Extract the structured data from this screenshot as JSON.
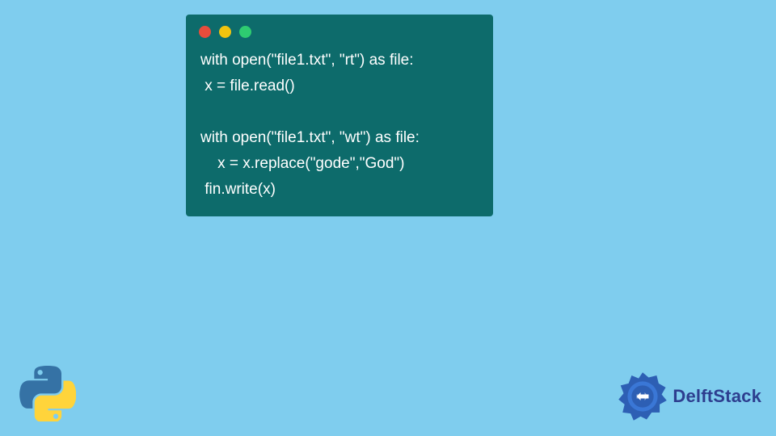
{
  "colors": {
    "background": "#7fcdee",
    "code_window_bg": "#0d6b6b",
    "code_text": "#ffffff",
    "dot_red": "#e74c3c",
    "dot_yellow": "#f1c40f",
    "dot_green": "#2ecc71",
    "brand_blue": "#2d3e8f"
  },
  "code": {
    "line1": "with open(\"file1.txt\", \"rt\") as file:",
    "line2": " x = file.read()",
    "line3": " ",
    "line4": "with open(\"file1.txt\", \"wt\") as file:",
    "line5": "    x = x.replace(\"gode\",\"God\")",
    "line6": " fin.write(x)"
  },
  "brand": {
    "name": "DelftStack"
  },
  "icons": {
    "bottom_left": "python-logo",
    "bottom_right": "delftstack-badge"
  }
}
